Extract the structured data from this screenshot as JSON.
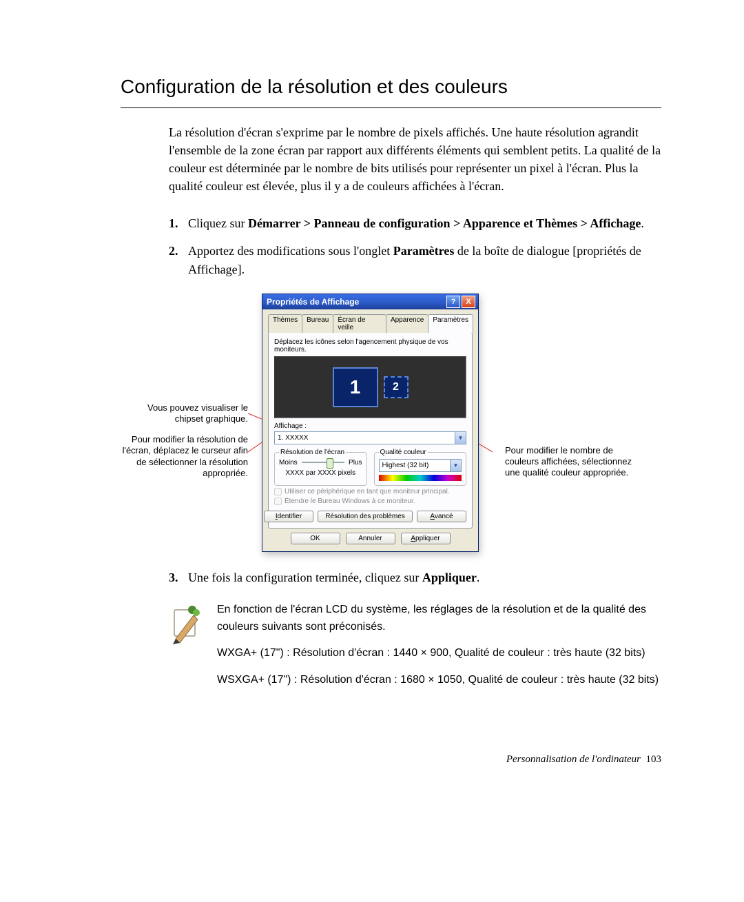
{
  "heading": "Configuration de la résolution et des couleurs",
  "intro": "La résolution d'écran s'exprime par le nombre de pixels affichés. Une haute résolution agrandit l'ensemble de la zone écran par rapport aux différents éléments qui semblent petits. La qualité de la couleur est déterminée par le nombre de bits utilisés pour représenter un pixel à l'écran. Plus la qualité couleur est élevée, plus il y a de couleurs affichées à l'écran.",
  "step1_a": "Cliquez sur ",
  "step1_b": "Démarrer > Panneau de configuration > Apparence et Thèmes > Affichage",
  "step1_c": ".",
  "step2_a": "Apportez des modifications sous l'onglet ",
  "step2_b": "Paramètres",
  "step2_c": " de la boîte de dialogue [propriétés de Affichage].",
  "step3_a": "Une fois la configuration terminée, cliquez sur ",
  "step3_b": "Appliquer",
  "step3_c": ".",
  "callouts": {
    "left1": "Vous pouvez visualiser le chipset graphique.",
    "left2": "Pour modifier la résolution de l'écran, déplacez le curseur afin de sélectionner la résolution appropriée.",
    "right1": "Pour modifier le nombre de couleurs affichées, sélectionnez une qualité couleur appropriée."
  },
  "dialog": {
    "title": "Propriétés de Affichage",
    "help": "?",
    "close": "X",
    "tabs": [
      "Thèmes",
      "Bureau",
      "Écran de veille",
      "Apparence",
      "Paramètres"
    ],
    "hint": "Déplacez les icônes selon l'agencement physique de vos moniteurs.",
    "mon1": "1",
    "mon2": "2",
    "display_label": "Affichage :",
    "display_value": "1. XXXXX",
    "res_legend": "Résolution de l'écran",
    "less": "Moins",
    "more": "Plus",
    "res_val": "XXXX par XXXX pixels",
    "color_legend": "Qualité couleur",
    "color_value": "Highest (32 bit)",
    "chk1": "Utiliser ce périphérique en tant que moniteur principal.",
    "chk2": "Étendre le Bureau Windows à ce moniteur.",
    "btn_identify": "Identifier",
    "btn_troubleshoot": "Résolution des problèmes",
    "btn_advanced": "Avancé",
    "btn_ok": "OK",
    "btn_cancel": "Annuler",
    "btn_apply": "Appliquer"
  },
  "note": {
    "p1": "En fonction de l'écran LCD du système, les réglages de la résolution et de la qualité des couleurs suivants sont préconisés.",
    "p2": "WXGA+ (17\") : Résolution d'écran : 1440 × 900, Qualité de couleur : très haute (32 bits)",
    "p3": "WSXGA+ (17\") : Résolution d'écran : 1680 × 1050, Qualité de couleur : très haute (32 bits)"
  },
  "footer_text": "Personnalisation de l'ordinateur",
  "footer_page": "103"
}
